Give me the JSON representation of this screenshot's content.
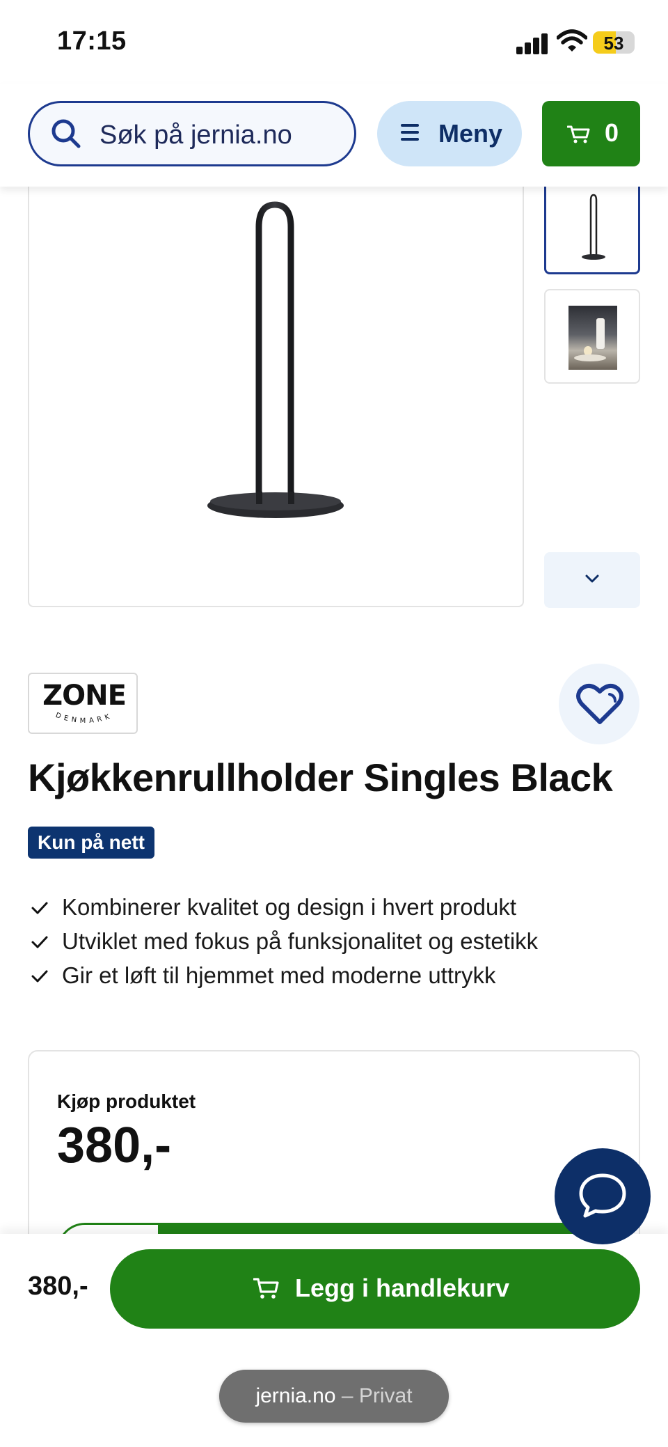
{
  "status_bar": {
    "time": "17:15",
    "battery": "53"
  },
  "header": {
    "search_placeholder": "Søk på jernia.no",
    "menu_label": "Meny",
    "cart_count": "0"
  },
  "gallery": {
    "main_image_icon": "paper-towel-holder-image",
    "thumbnails": [
      "product-photo",
      "lifestyle-photo"
    ]
  },
  "product": {
    "brand": {
      "name": "ZONE",
      "sub": "DENMARK"
    },
    "title": "Kjøkkenrullholder Singles Black",
    "badge": "Kun på nett",
    "features": [
      "Kombinerer kvalitet og design i hvert produkt",
      "Utviklet med fokus på funksjonalitet og estetikk",
      "Gir et løft til hjemmet med moderne uttrykk"
    ]
  },
  "buy_box": {
    "heading": "Kjøp produktet",
    "price": "380,-"
  },
  "sticky_bar": {
    "price": "380,-",
    "add_to_cart_label": "Legg i handlekurv"
  },
  "browser": {
    "domain": "jernia.no",
    "mode": " – Privat"
  },
  "colors": {
    "primary_green": "#208216",
    "navy": "#0d3470",
    "light_blue": "#cfe5f8"
  }
}
